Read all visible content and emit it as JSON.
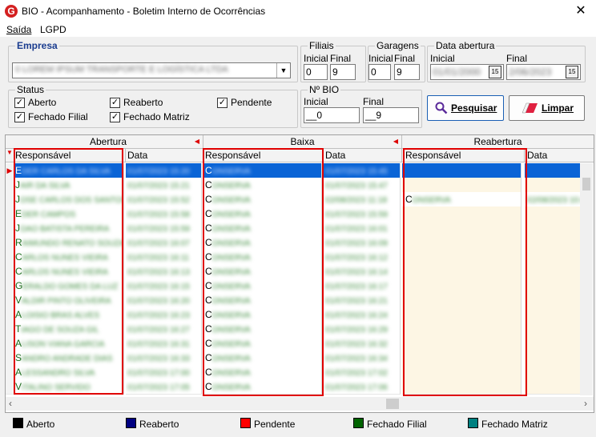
{
  "window": {
    "title": "BIO - Acompanhamento - Boletim Interno de Ocorrências",
    "app_icon": "G",
    "close": "✕"
  },
  "menu": [
    {
      "label": "Saída"
    },
    {
      "label": "LGPD"
    }
  ],
  "empresa": {
    "label": "Empresa",
    "value": "0 LOREM IPSUM TRANSPORTE E LOGÍSTICA LTDA"
  },
  "filiais": {
    "label": "Filiais",
    "inicial_label": "Inicial",
    "final_label": "Final",
    "inicial": "0",
    "final": "9"
  },
  "garagens": {
    "label": "Garagens",
    "inicial_label": "Inicial",
    "final_label": "Final",
    "inicial": "0",
    "final": "9"
  },
  "data_abertura": {
    "label": "Data abertura",
    "inicial_label": "Inicial",
    "final_label": "Final",
    "inicial": "01/01/2000",
    "final": "2/06/2023",
    "cal": "15"
  },
  "status": {
    "label": "Status",
    "items": [
      {
        "label": "Aberto",
        "checked": true
      },
      {
        "label": "Reaberto",
        "checked": true
      },
      {
        "label": "Pendente",
        "checked": true
      },
      {
        "label": "Fechado Filial",
        "checked": true
      },
      {
        "label": "Fechado Matriz",
        "checked": true
      }
    ]
  },
  "nbio": {
    "label": "Nº BIO",
    "inicial_label": "Inicial",
    "final_label": "Final",
    "inicial": "__0",
    "final": "__9"
  },
  "buttons": {
    "pesquisar": "Pesquisar",
    "limpar": "Limpar"
  },
  "grid": {
    "groups": [
      "Abertura",
      "Baixa",
      "Reabertura"
    ],
    "columns": [
      "Responsável",
      "Data",
      "Responsável",
      "Data",
      "Responsável",
      "Data"
    ],
    "rows": [
      {
        "a": "EDER CARLOS DA SILVA",
        "ad": "01/07/2023 15:20",
        "b": "CONSERVA",
        "bd": "01/07/2023 15:45",
        "r": "",
        "rd": ""
      },
      {
        "a": "JAIR DA SILVA",
        "ad": "01/07/2023 15:21",
        "b": "CONSERVA",
        "bd": "01/07/2023 15:47",
        "r": "",
        "rd": ""
      },
      {
        "a": "JOSE CARLOS DOS SANTOS",
        "ad": "01/07/2023 15:52",
        "b": "CONSERVA",
        "bd": "02/08/2023 11:18",
        "r": "CONSERVA",
        "rd": "02/08/2023 10:44"
      },
      {
        "a": "EDER CAMPOS",
        "ad": "01/07/2023 15:58",
        "b": "CONSERVA",
        "bd": "01/07/2023 15:59",
        "r": "",
        "rd": ""
      },
      {
        "a": "JOAO BATISTA PEREIRA",
        "ad": "01/07/2023 15:59",
        "b": "CONSERVA",
        "bd": "01/07/2023 16:01",
        "r": "",
        "rd": ""
      },
      {
        "a": "RAIMUNDO RENATO SOUZA",
        "ad": "01/07/2023 16:07",
        "b": "CONSERVA",
        "bd": "01/07/2023 16:09",
        "r": "",
        "rd": ""
      },
      {
        "a": "CARLOS NUNES VIEIRA",
        "ad": "01/07/2023 16:11",
        "b": "CONSERVA",
        "bd": "01/07/2023 16:12",
        "r": "",
        "rd": ""
      },
      {
        "a": "CARLOS NUNES VIEIRA",
        "ad": "01/07/2023 16:13",
        "b": "CONSERVA",
        "bd": "01/07/2023 16:14",
        "r": "",
        "rd": ""
      },
      {
        "a": "GERALDO GOMES DA LUZ",
        "ad": "01/07/2023 16:15",
        "b": "CONSERVA",
        "bd": "01/07/2023 16:17",
        "r": "",
        "rd": ""
      },
      {
        "a": "VALDIR PINTO OLIVEIRA",
        "ad": "01/07/2023 16:20",
        "b": "CONSERVA",
        "bd": "01/07/2023 16:21",
        "r": "",
        "rd": ""
      },
      {
        "a": "ALOISIO BRAS ALVES",
        "ad": "01/07/2023 16:23",
        "b": "CONSERVA",
        "bd": "01/07/2023 16:24",
        "r": "",
        "rd": ""
      },
      {
        "a": "TIAGO DE SOUZA GIL",
        "ad": "01/07/2023 16:27",
        "b": "CONSERVA",
        "bd": "01/07/2023 16:29",
        "r": "",
        "rd": ""
      },
      {
        "a": "ALISON VIANA GARCIA",
        "ad": "01/07/2023 16:31",
        "b": "CONSERVA",
        "bd": "01/07/2023 16:32",
        "r": "",
        "rd": ""
      },
      {
        "a": "SANDRO ANDRADE DIAS",
        "ad": "01/07/2023 16:33",
        "b": "CONSERVA",
        "bd": "01/07/2023 16:34",
        "r": "",
        "rd": ""
      },
      {
        "a": "ALESSANDRO SILVA",
        "ad": "01/07/2023 17:00",
        "b": "CONSERVA",
        "bd": "01/07/2023 17:02",
        "r": "",
        "rd": ""
      },
      {
        "a": "VITALINO SERVIDO",
        "ad": "01/07/2023 17:05",
        "b": "CONSERVA",
        "bd": "01/07/2023 17:06",
        "r": "",
        "rd": ""
      }
    ]
  },
  "legend": [
    {
      "label": "Aberto",
      "color": "#000000"
    },
    {
      "label": "Reaberto",
      "color": "#000080"
    },
    {
      "label": "Pendente",
      "color": "#ff0000"
    },
    {
      "label": "Fechado Filial",
      "color": "#006400"
    },
    {
      "label": "Fechado Matriz",
      "color": "#008080"
    }
  ]
}
